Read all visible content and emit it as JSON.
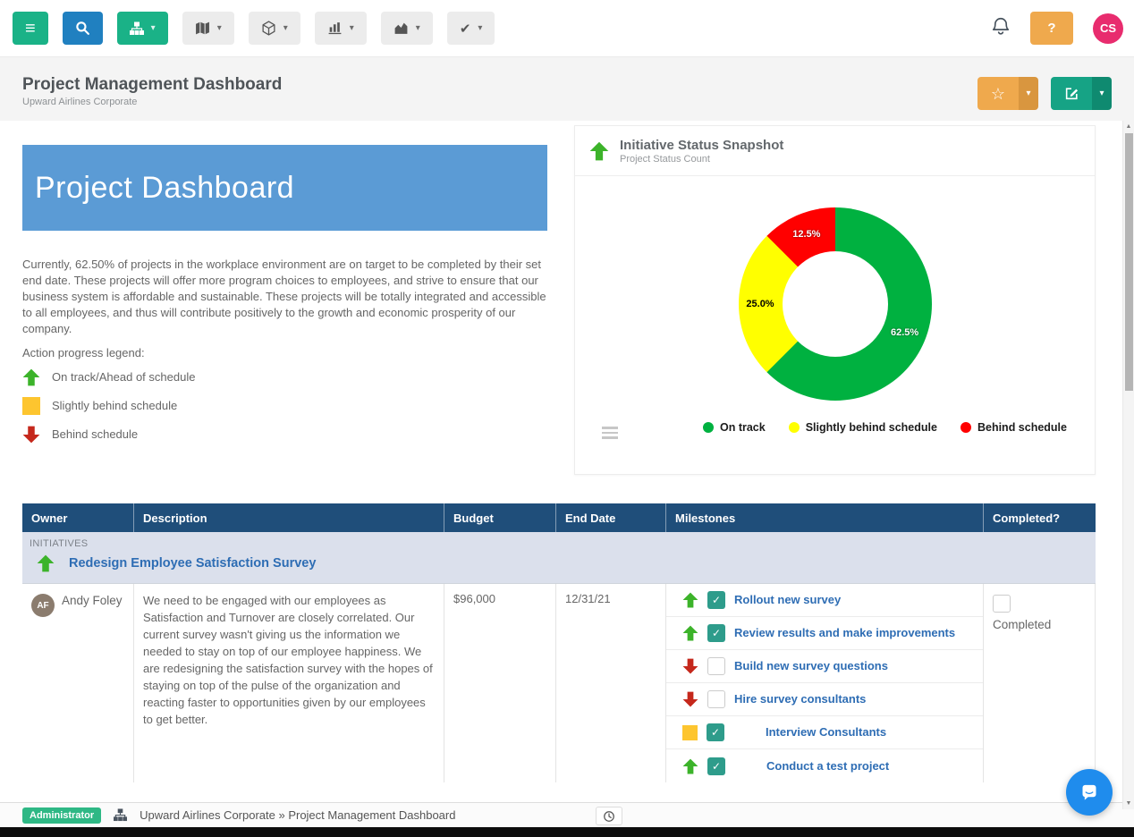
{
  "toolbar": {
    "buttons": [
      {
        "name": "menu",
        "icon": "menu-icon",
        "style": "solid-green",
        "caret": false
      },
      {
        "name": "search",
        "icon": "search-icon",
        "style": "solid-blue",
        "caret": false
      },
      {
        "name": "sitemap",
        "icon": "sitemap-icon",
        "style": "solid-green",
        "caret": true
      },
      {
        "name": "map",
        "icon": "map-icon",
        "style": "light",
        "caret": true
      },
      {
        "name": "cube",
        "icon": "cube-icon",
        "style": "light",
        "caret": true
      },
      {
        "name": "bar-chart",
        "icon": "bar-chart-icon",
        "style": "light",
        "caret": true
      },
      {
        "name": "area-chart",
        "icon": "area-chart-icon",
        "style": "light",
        "caret": true
      },
      {
        "name": "check",
        "icon": "check-icon",
        "style": "light",
        "caret": true
      }
    ],
    "help_label": "?",
    "avatar_initials": "CS"
  },
  "page_header": {
    "title": "Project Management Dashboard",
    "subtitle": "Upward Airlines Corporate"
  },
  "banner": {
    "title": "Project Dashboard"
  },
  "intro": {
    "paragraph": "Currently, 62.50% of projects in the workplace environment are on target to be completed by their set end date. These projects will offer more program choices to employees, and strive to ensure that our business system is affordable and sustainable. These projects will be totally integrated and accessible to all employees, and thus will contribute positively to the growth and economic prosperity of our company.",
    "legend_title": "Action progress legend:",
    "legend": [
      {
        "status": "up",
        "label": "On track/Ahead of schedule"
      },
      {
        "status": "square",
        "label": "Slightly behind schedule"
      },
      {
        "status": "down",
        "label": "Behind schedule"
      }
    ]
  },
  "chart_panel": {
    "title": "Initiative Status Snapshot",
    "subtitle": "Project Status Count"
  },
  "chart_data": {
    "type": "pie",
    "donut": true,
    "title": "Initiative Status Snapshot",
    "subtitle": "Project Status Count",
    "labels": [
      "On track",
      "Slightly behind schedule",
      "Behind schedule"
    ],
    "values": [
      62.5,
      25.0,
      12.5
    ],
    "value_labels": [
      "62.5%",
      "25.0%",
      "12.5%"
    ],
    "colors": [
      "#00b140",
      "#ffff00",
      "#ff0000"
    ],
    "legend_position": "bottom"
  },
  "table": {
    "columns": [
      "Owner",
      "Description",
      "Budget",
      "End Date",
      "Milestones",
      "Completed?"
    ],
    "section_label": "INITIATIVES",
    "initiative": {
      "status": "up",
      "title": "Redesign Employee Satisfaction Survey"
    },
    "row": {
      "owner_initials": "AF",
      "owner_name": "Andy Foley",
      "description": "We need to be engaged with our employees as Satisfaction and Turnover are closely correlated. Our current survey wasn't giving us the information we needed to stay on top of our employee happiness.  We are redesigning the satisfaction survey with the hopes of staying on top of the pulse of the organization and reacting faster to opportunities given by our employees to get better.",
      "budget": "$96,000",
      "end_date": "12/31/21",
      "milestones": [
        {
          "status": "up",
          "checked": true,
          "indent": false,
          "label": "Rollout new survey"
        },
        {
          "status": "up",
          "checked": true,
          "indent": false,
          "label": "Review results and make improvements"
        },
        {
          "status": "down",
          "checked": false,
          "indent": false,
          "label": "Build new survey questions"
        },
        {
          "status": "down",
          "checked": false,
          "indent": false,
          "label": "Hire survey consultants"
        },
        {
          "status": "square",
          "checked": true,
          "indent": true,
          "label": "Interview Consultants"
        },
        {
          "status": "up",
          "checked": true,
          "indent": true,
          "label": "Conduct a test project"
        }
      ],
      "completed": {
        "checked": false,
        "label": "Completed"
      }
    }
  },
  "footer": {
    "badge": "Administrator",
    "breadcrumb": "Upward Airlines Corporate » Project Management Dashboard"
  },
  "colors": {
    "accent_green": "#1ab287",
    "accent_blue": "#2080c0",
    "accent_orange": "#efa94d",
    "header_navy": "#1f4e7a",
    "banner_blue": "#5b9bd5",
    "link_blue": "#2e6db4",
    "status_green": "#3cb32a",
    "status_yellow": "#fdc52f",
    "status_red": "#c5281c",
    "checkbox_teal": "#2e9c8b",
    "avatar_pink": "#e82c6e",
    "badge_green": "#2eb885",
    "chat_blue": "#1f8ced"
  }
}
